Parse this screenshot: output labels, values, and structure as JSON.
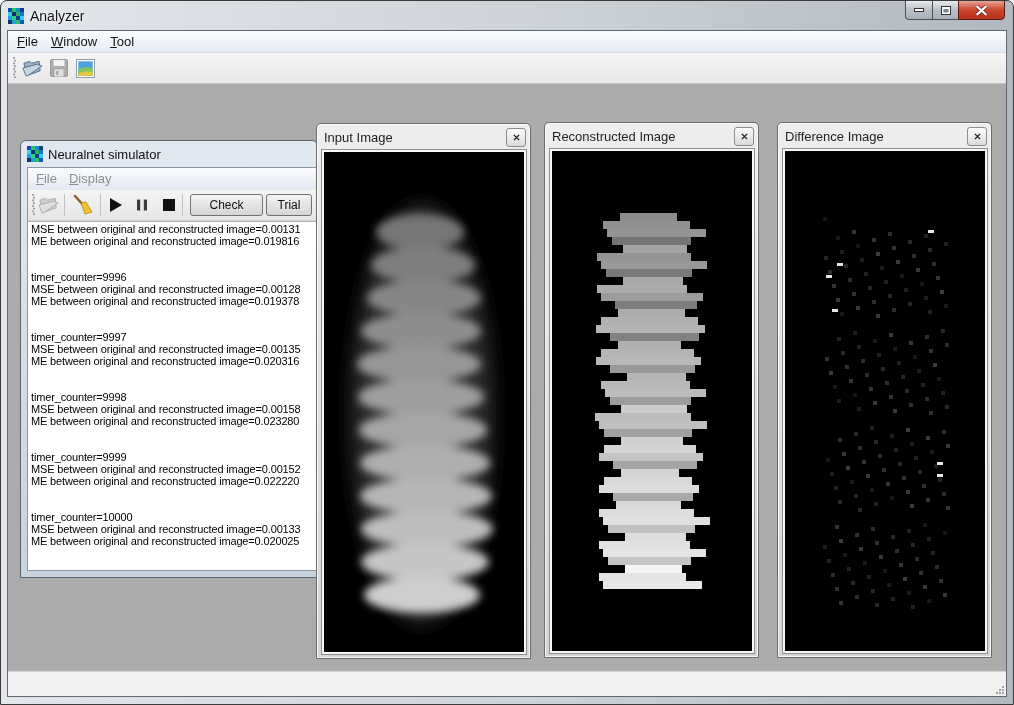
{
  "window": {
    "title": "Analyzer"
  },
  "menu_bar": [
    {
      "label": "File",
      "access_key_underlined": true,
      "disabled": false
    },
    {
      "label": "Window",
      "access_key_underlined": true,
      "disabled": false
    },
    {
      "label": "Tool",
      "access_key_underlined": true,
      "disabled": false
    }
  ],
  "toolbar": {
    "open_button": {
      "disabled": false
    },
    "save_button": {
      "disabled": true
    },
    "image_button": {
      "disabled": false
    }
  },
  "simulator_window": {
    "title": "Neuralnet simulator",
    "menu_bar": [
      {
        "label": "File",
        "access_key_underlined": true,
        "disabled": true
      },
      {
        "label": "Display",
        "access_key_underlined": true,
        "disabled": true
      }
    ],
    "toolbar": {
      "open_button": {
        "disabled": true
      },
      "clear_button": {
        "disabled": false
      },
      "play_button": {
        "disabled": false
      },
      "pause_button": {
        "disabled": false
      },
      "stop_button": {
        "disabled": false
      },
      "text_buttons": [
        {
          "label": "Check"
        },
        {
          "label": "Trial"
        }
      ]
    },
    "log": [
      {
        "lines": [
          "MSE between original and reconstructed image=0.00131",
          "ME between original and reconstructed image=0.019816"
        ]
      },
      {
        "lines": [
          "timer_counter=9996",
          "MSE between original and reconstructed image=0.00128",
          "ME between original and reconstructed image=0.019378"
        ]
      },
      {
        "lines": [
          "timer_counter=9997",
          "MSE between original and reconstructed image=0.00135",
          "ME between original and reconstructed image=0.020316"
        ]
      },
      {
        "lines": [
          "timer_counter=9998",
          "MSE between original and reconstructed image=0.00158",
          "ME between original and reconstructed image=0.023280"
        ]
      },
      {
        "lines": [
          "timer_counter=9999",
          "MSE between original and reconstructed image=0.00152",
          "ME between original and reconstructed image=0.022220"
        ]
      },
      {
        "lines": [
          "timer_counter=10000",
          "MSE between original and reconstructed image=0.00133",
          "ME between original and reconstructed image=0.020025"
        ]
      }
    ]
  },
  "image_windows": [
    {
      "title": "Input Image",
      "kind": "blurred"
    },
    {
      "title": "Reconstructed Image",
      "kind": "blocky"
    },
    {
      "title": "Difference Image",
      "kind": "sparse"
    }
  ]
}
